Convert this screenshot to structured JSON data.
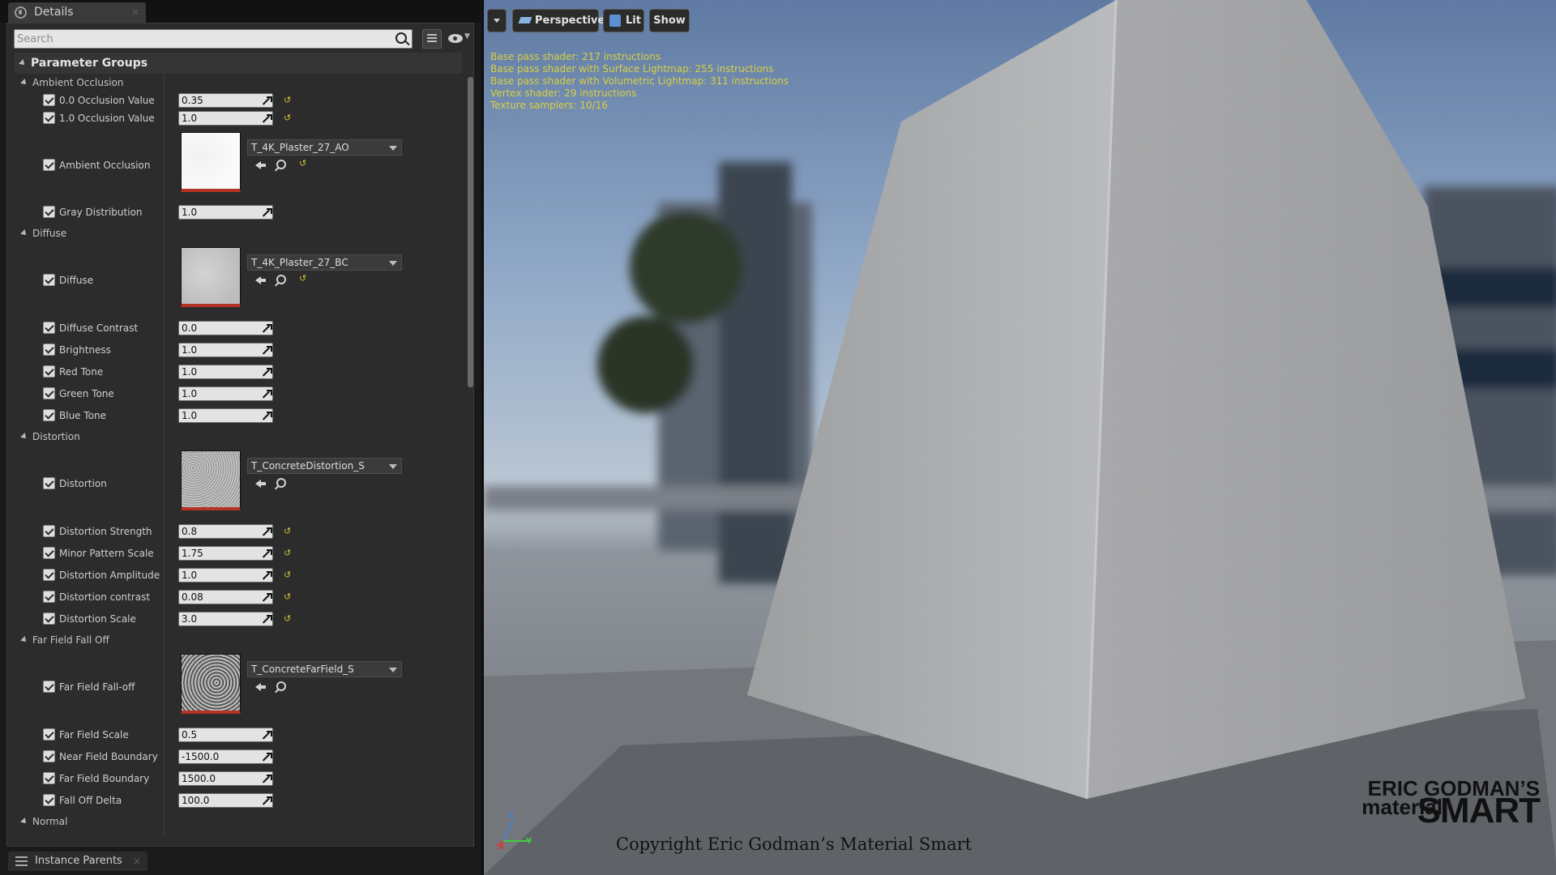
{
  "details_tab": {
    "title": "Details",
    "close": "×"
  },
  "search": {
    "placeholder": "Search"
  },
  "header": {
    "title": "Parameter Groups"
  },
  "groups": {
    "ambient_occlusion": "Ambient Occlusion",
    "diffuse": "Diffuse",
    "distortion": "Distortion",
    "far_field": "Far Field Fall Off",
    "normal": "Normal"
  },
  "params": {
    "occ0": {
      "label": "0.0 Occlusion Value",
      "value": "0.35"
    },
    "occ1": {
      "label": "1.0 Occlusion Value",
      "value": "1.0"
    },
    "ao_tex": {
      "label": "Ambient Occlusion",
      "asset": "T_4K_Plaster_27_AO"
    },
    "gray": {
      "label": "Gray Distribution",
      "value": "1.0"
    },
    "diffuse_tex": {
      "label": "Diffuse",
      "asset": "T_4K_Plaster_27_BC"
    },
    "diff_contrast": {
      "label": "Diffuse Contrast",
      "value": "0.0"
    },
    "brightness": {
      "label": "Brightness",
      "value": "1.0"
    },
    "red": {
      "label": "Red Tone",
      "value": "1.0"
    },
    "green": {
      "label": "Green Tone",
      "value": "1.0"
    },
    "blue": {
      "label": "Blue Tone",
      "value": "1.0"
    },
    "dist_tex": {
      "label": "Distortion",
      "asset": "T_ConcreteDistortion_S"
    },
    "dist_strength": {
      "label": "Distortion Strength",
      "value": "0.8"
    },
    "minor_scale": {
      "label": "Minor Pattern Scale",
      "value": "1.75"
    },
    "dist_amp": {
      "label": "Distortion Amplitude",
      "value": "1.0"
    },
    "dist_contrast": {
      "label": "Distortion contrast",
      "value": "0.08"
    },
    "dist_scale": {
      "label": "Distortion Scale",
      "value": "3.0"
    },
    "far_tex": {
      "label": "Far Field Fall-off",
      "asset": "T_ConcreteFarField_S"
    },
    "far_scale": {
      "label": "Far Field Scale",
      "value": "0.5"
    },
    "near_boundary": {
      "label": "Near Field Boundary",
      "value": "-1500.0"
    },
    "far_boundary": {
      "label": "Far Field Boundary",
      "value": "1500.0"
    },
    "falloff_delta": {
      "label": "Fall Off Delta",
      "value": "100.0"
    }
  },
  "reset_glyph": "↺",
  "bottom_tab": {
    "title": "Instance Parents",
    "close": "×"
  },
  "viewport": {
    "perspective": "Perspective",
    "lit": "Lit",
    "show": "Show",
    "stats": [
      "Base pass shader: 217 instructions",
      "Base pass shader with Surface Lightmap: 255 instructions",
      "Base pass shader with Volumetric Lightmap: 311 instructions",
      "Vertex shader: 29 instructions",
      "Texture samplers: 10/16"
    ],
    "axis": {
      "x": "X",
      "y": "Y",
      "z": "Z"
    },
    "copyright": "Copyright Eric Godman’s Material Smart",
    "logo": {
      "line1": "ERIC GODMAN’S",
      "line2": "material",
      "line3": "SMART"
    }
  },
  "colors": {
    "accent_reset": "#d4c23a",
    "thumb_underline": "#b53226",
    "stats_text": "#d8d040"
  }
}
